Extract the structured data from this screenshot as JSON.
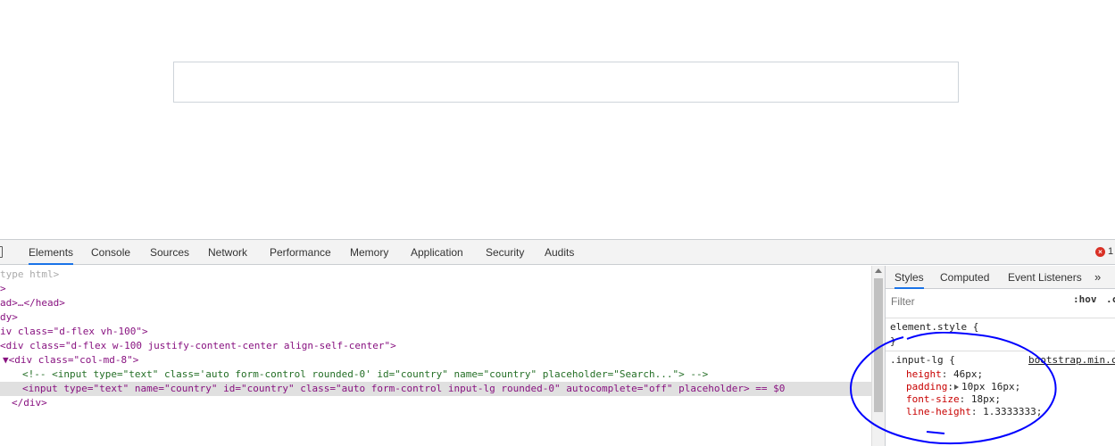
{
  "page": {
    "input_value": "",
    "input_placeholder": ""
  },
  "devtools": {
    "tabs": [
      "Elements",
      "Console",
      "Sources",
      "Network",
      "Performance",
      "Memory",
      "Application",
      "Security",
      "Audits"
    ],
    "active_tab": "Elements",
    "error_count": "1",
    "dom_lines": [
      {
        "text": "type html>"
      },
      {
        "text": ">"
      },
      {
        "text": "ad>…</head>"
      },
      {
        "text": "dy>"
      },
      {
        "text": "iv class=\"d-flex vh-100\">"
      },
      {
        "text": "<div class=\"d-flex w-100 justify-content-center align-self-center\">"
      },
      {
        "text": "▼<div class=\"col-md-8\">"
      },
      {
        "text": "<!-- <input type=\"text\" class='auto form-control rounded-0' id=\"country\" name=\"country\" placeholder=\"Search...\"> -->"
      },
      {
        "text": "<input type=\"text\" name=\"country\" id=\"country\" class=\"auto form-control input-lg rounded-0\" autocomplete=\"off\" placeholder> == $0"
      },
      {
        "text": "</div>"
      }
    ],
    "styles_pane": {
      "tabs": [
        "Styles",
        "Computed",
        "Event Listeners",
        "»"
      ],
      "active_tab": "Styles",
      "filter_placeholder": "Filter",
      "hov_label": ":hov",
      "cls_label": ".c",
      "element_style_open": "element.style {",
      "element_style_close": "}",
      "rule_selector": ".input-lg {",
      "rule_source": "bootstrap.min.c",
      "declarations": [
        {
          "prop": "height",
          "value": "46px;"
        },
        {
          "prop": "padding",
          "value": "10px 16px;"
        },
        {
          "prop": "font-size",
          "value": "18px;"
        },
        {
          "prop": "line-height",
          "value": "1.3333333;"
        }
      ]
    },
    "annotation_color": "#0000ff"
  }
}
